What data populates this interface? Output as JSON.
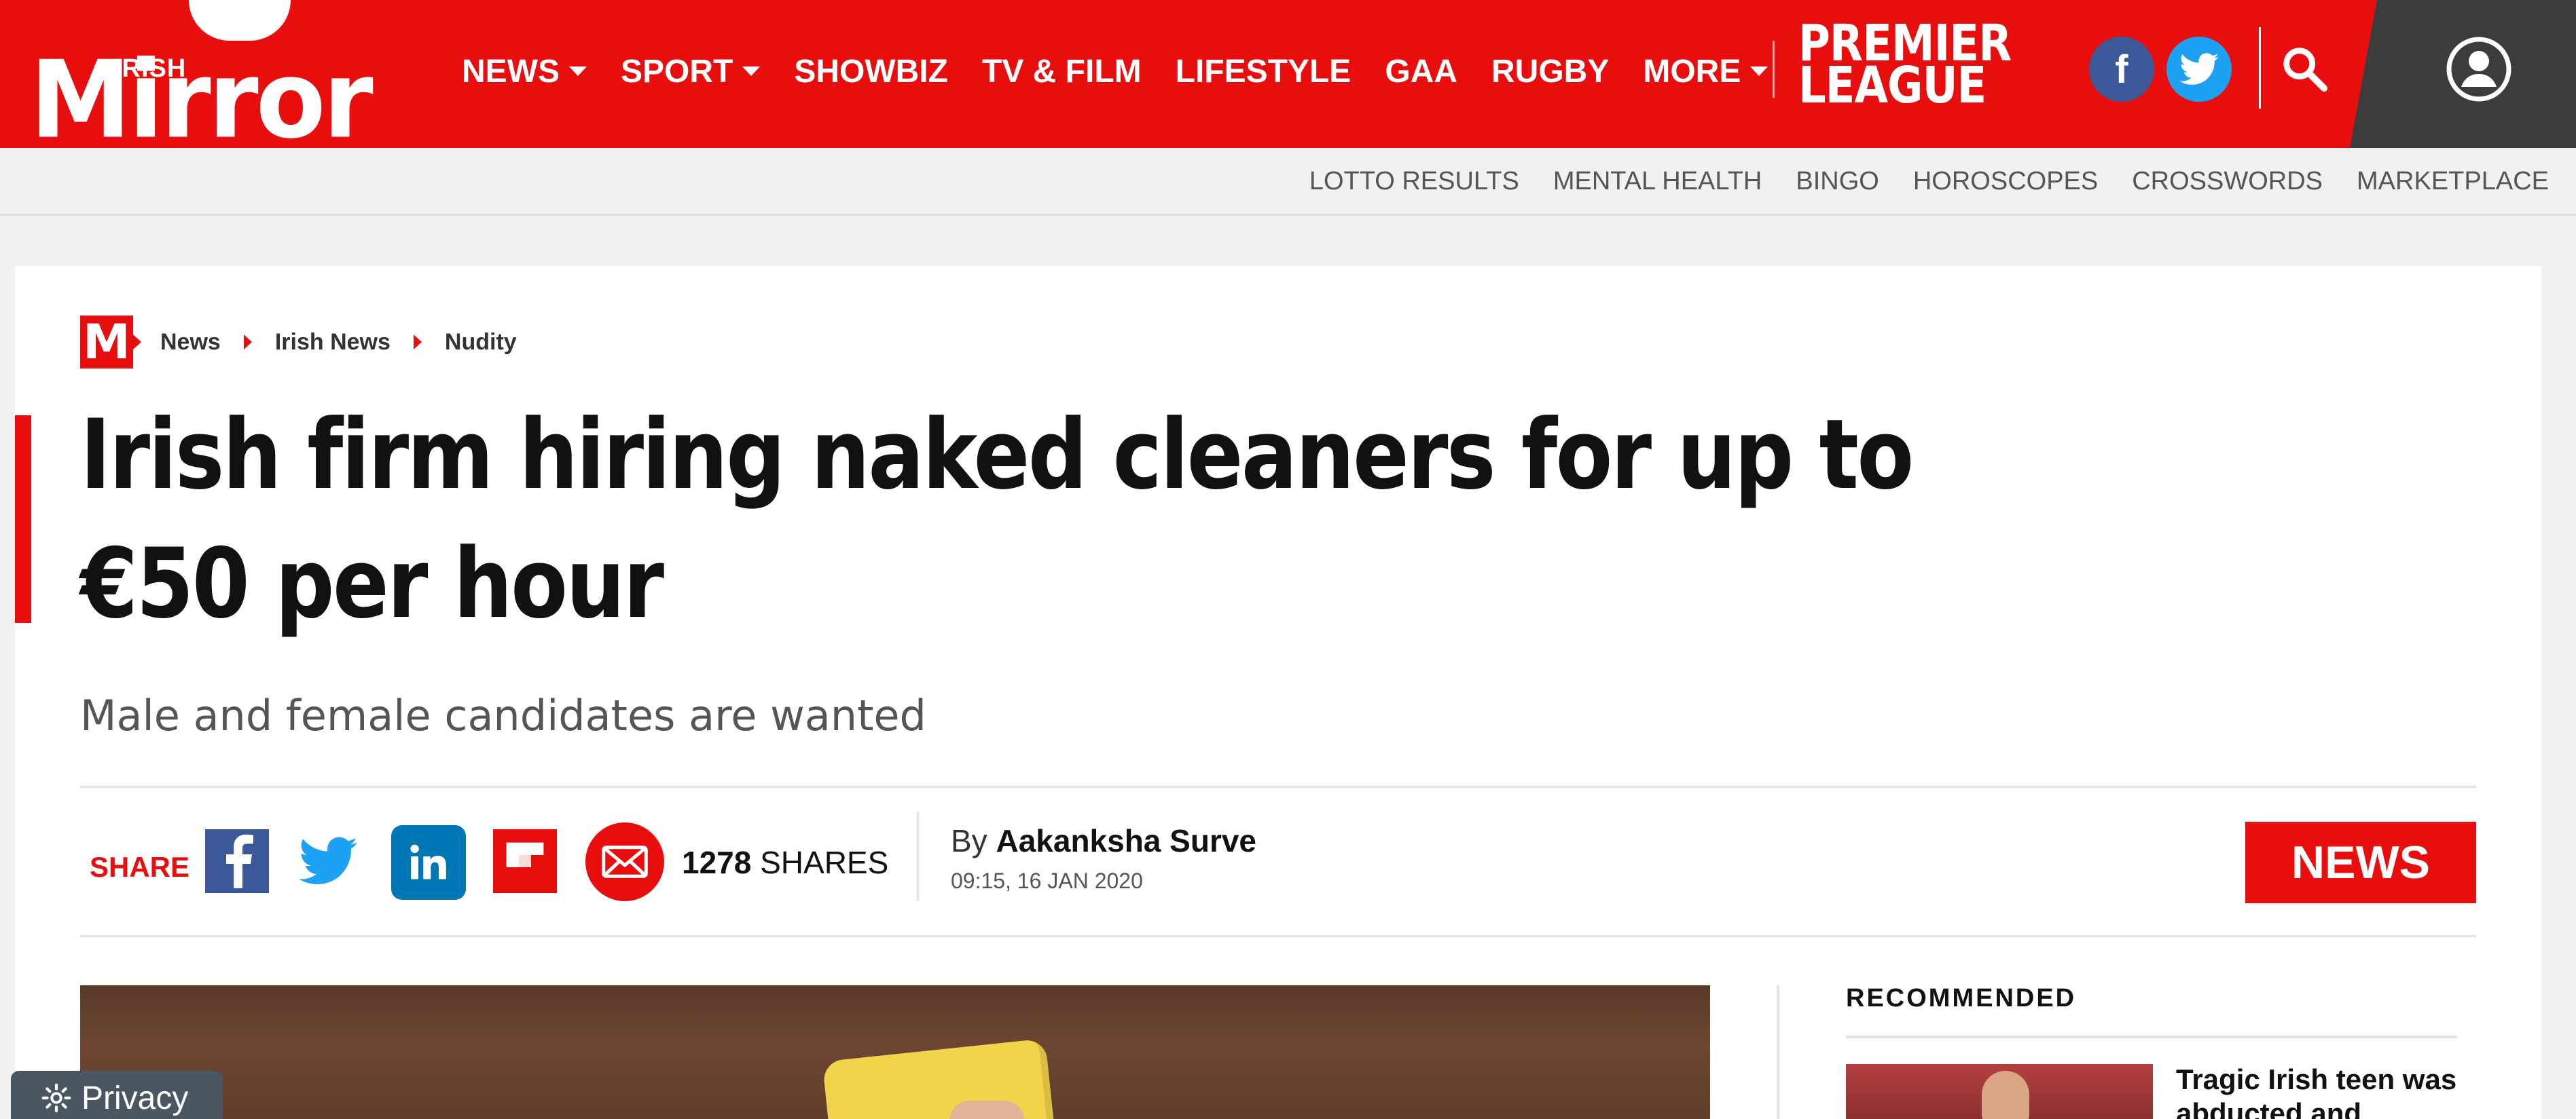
{
  "header": {
    "logo_top": "IRISH",
    "logo_main": "Mirror",
    "nav": [
      {
        "label": "NEWS",
        "has_dropdown": true
      },
      {
        "label": "SPORT",
        "has_dropdown": true
      },
      {
        "label": "SHOWBIZ",
        "has_dropdown": false
      },
      {
        "label": "TV & FILM",
        "has_dropdown": false
      },
      {
        "label": "LIFESTYLE",
        "has_dropdown": false
      },
      {
        "label": "GAA",
        "has_dropdown": false
      },
      {
        "label": "RUGBY",
        "has_dropdown": false
      },
      {
        "label": "MORE",
        "has_dropdown": true
      }
    ],
    "premier_line1": "PREMIER",
    "premier_line2": "LEAGUE",
    "facebook_glyph": "f",
    "accent_color": "#e90e0e"
  },
  "subnav": [
    "LOTTO RESULTS",
    "MENTAL HEALTH",
    "BINGO",
    "HOROSCOPES",
    "CROSSWORDS",
    "MARKETPLACE"
  ],
  "breadcrumb": {
    "logo_letter": "M",
    "items": [
      "News",
      "Irish News",
      "Nudity"
    ]
  },
  "article": {
    "headline": "Irish firm hiring naked cleaners for up to €50 per hour",
    "standfirst": "Male and female candidates are wanted",
    "share_label": "SHARE",
    "share_count": "1278",
    "shares_word": "SHARES",
    "by_prefix": "By",
    "author": "Aakanksha Surve",
    "date": "09:15, 16 JAN 2020",
    "category_badge": "NEWS",
    "share_icons": [
      "facebook-icon",
      "twitter-icon",
      "linkedin-icon",
      "flipboard-icon",
      "email-icon"
    ]
  },
  "sidebar": {
    "recommended_title": "RECOMMENDED",
    "items": [
      {
        "title": "Tragic Irish teen was abducted and"
      }
    ]
  },
  "privacy": {
    "label": "Privacy"
  }
}
